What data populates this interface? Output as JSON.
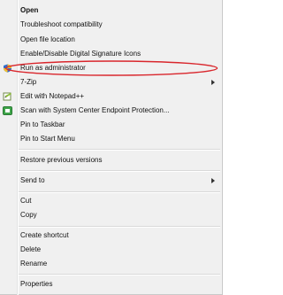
{
  "menu": {
    "items": [
      {
        "label": "Open",
        "bold": true
      },
      {
        "label": "Troubleshoot compatibility"
      },
      {
        "label": "Open file location"
      },
      {
        "label": "Enable/Disable Digital Signature Icons"
      },
      {
        "label": "Run as administrator",
        "icon": "uac-shield-icon"
      },
      {
        "label": "7-Zip",
        "submenu": true
      },
      {
        "label": "Edit with Notepad++",
        "icon": "notepadpp-icon"
      },
      {
        "label": "Scan with System Center Endpoint Protection...",
        "icon": "endpoint-protection-icon"
      },
      {
        "label": "Pin to Taskbar"
      },
      {
        "label": "Pin to Start Menu"
      },
      {
        "label": "Restore previous versions"
      },
      {
        "label": "Send to",
        "submenu": true
      },
      {
        "label": "Cut"
      },
      {
        "label": "Copy"
      },
      {
        "label": "Create shortcut"
      },
      {
        "label": "Delete"
      },
      {
        "label": "Rename"
      },
      {
        "label": "Properties"
      }
    ]
  },
  "annotation": {
    "color": "#d9262c",
    "target": "Run as administrator"
  }
}
